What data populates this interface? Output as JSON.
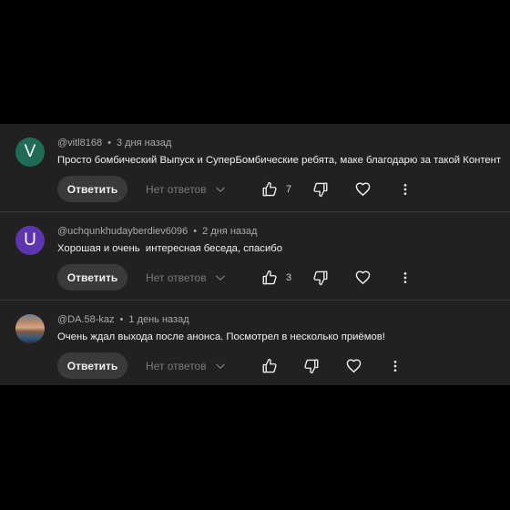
{
  "comments": [
    {
      "avatar_letter": "V",
      "avatar_color": "#1f6b56",
      "author": "@vitl8168",
      "time": "3 дня назад",
      "text": "Просто бомбический Выпуск и СуперБомбические ребята, маке благодарю за такой Контент",
      "reply_label": "Ответить",
      "replies_label": "Нет ответов",
      "likes": "7"
    },
    {
      "avatar_letter": "U",
      "avatar_color": "#5e35b1",
      "author": "@uchqunkhudayberdiev6096",
      "time": "2 дня назад",
      "text": "Хорошая и очень  интересная беседа, спасибо",
      "reply_label": "Ответить",
      "replies_label": "Нет ответов",
      "likes": "3"
    },
    {
      "avatar_letter": "",
      "avatar_color": "",
      "author": "@DA.58-kaz",
      "time": "1 день назад",
      "text": "Очень ждал выхода после анонса. Посмотрел в несколько приёмов!",
      "reply_label": "Ответить",
      "replies_label": "Нет ответов",
      "likes": ""
    }
  ],
  "icons": {
    "like": "thumb-up-icon",
    "dislike": "thumb-down-icon",
    "heart": "heart-icon",
    "more": "more-vert-icon",
    "chevron": "chevron-down-icon"
  }
}
